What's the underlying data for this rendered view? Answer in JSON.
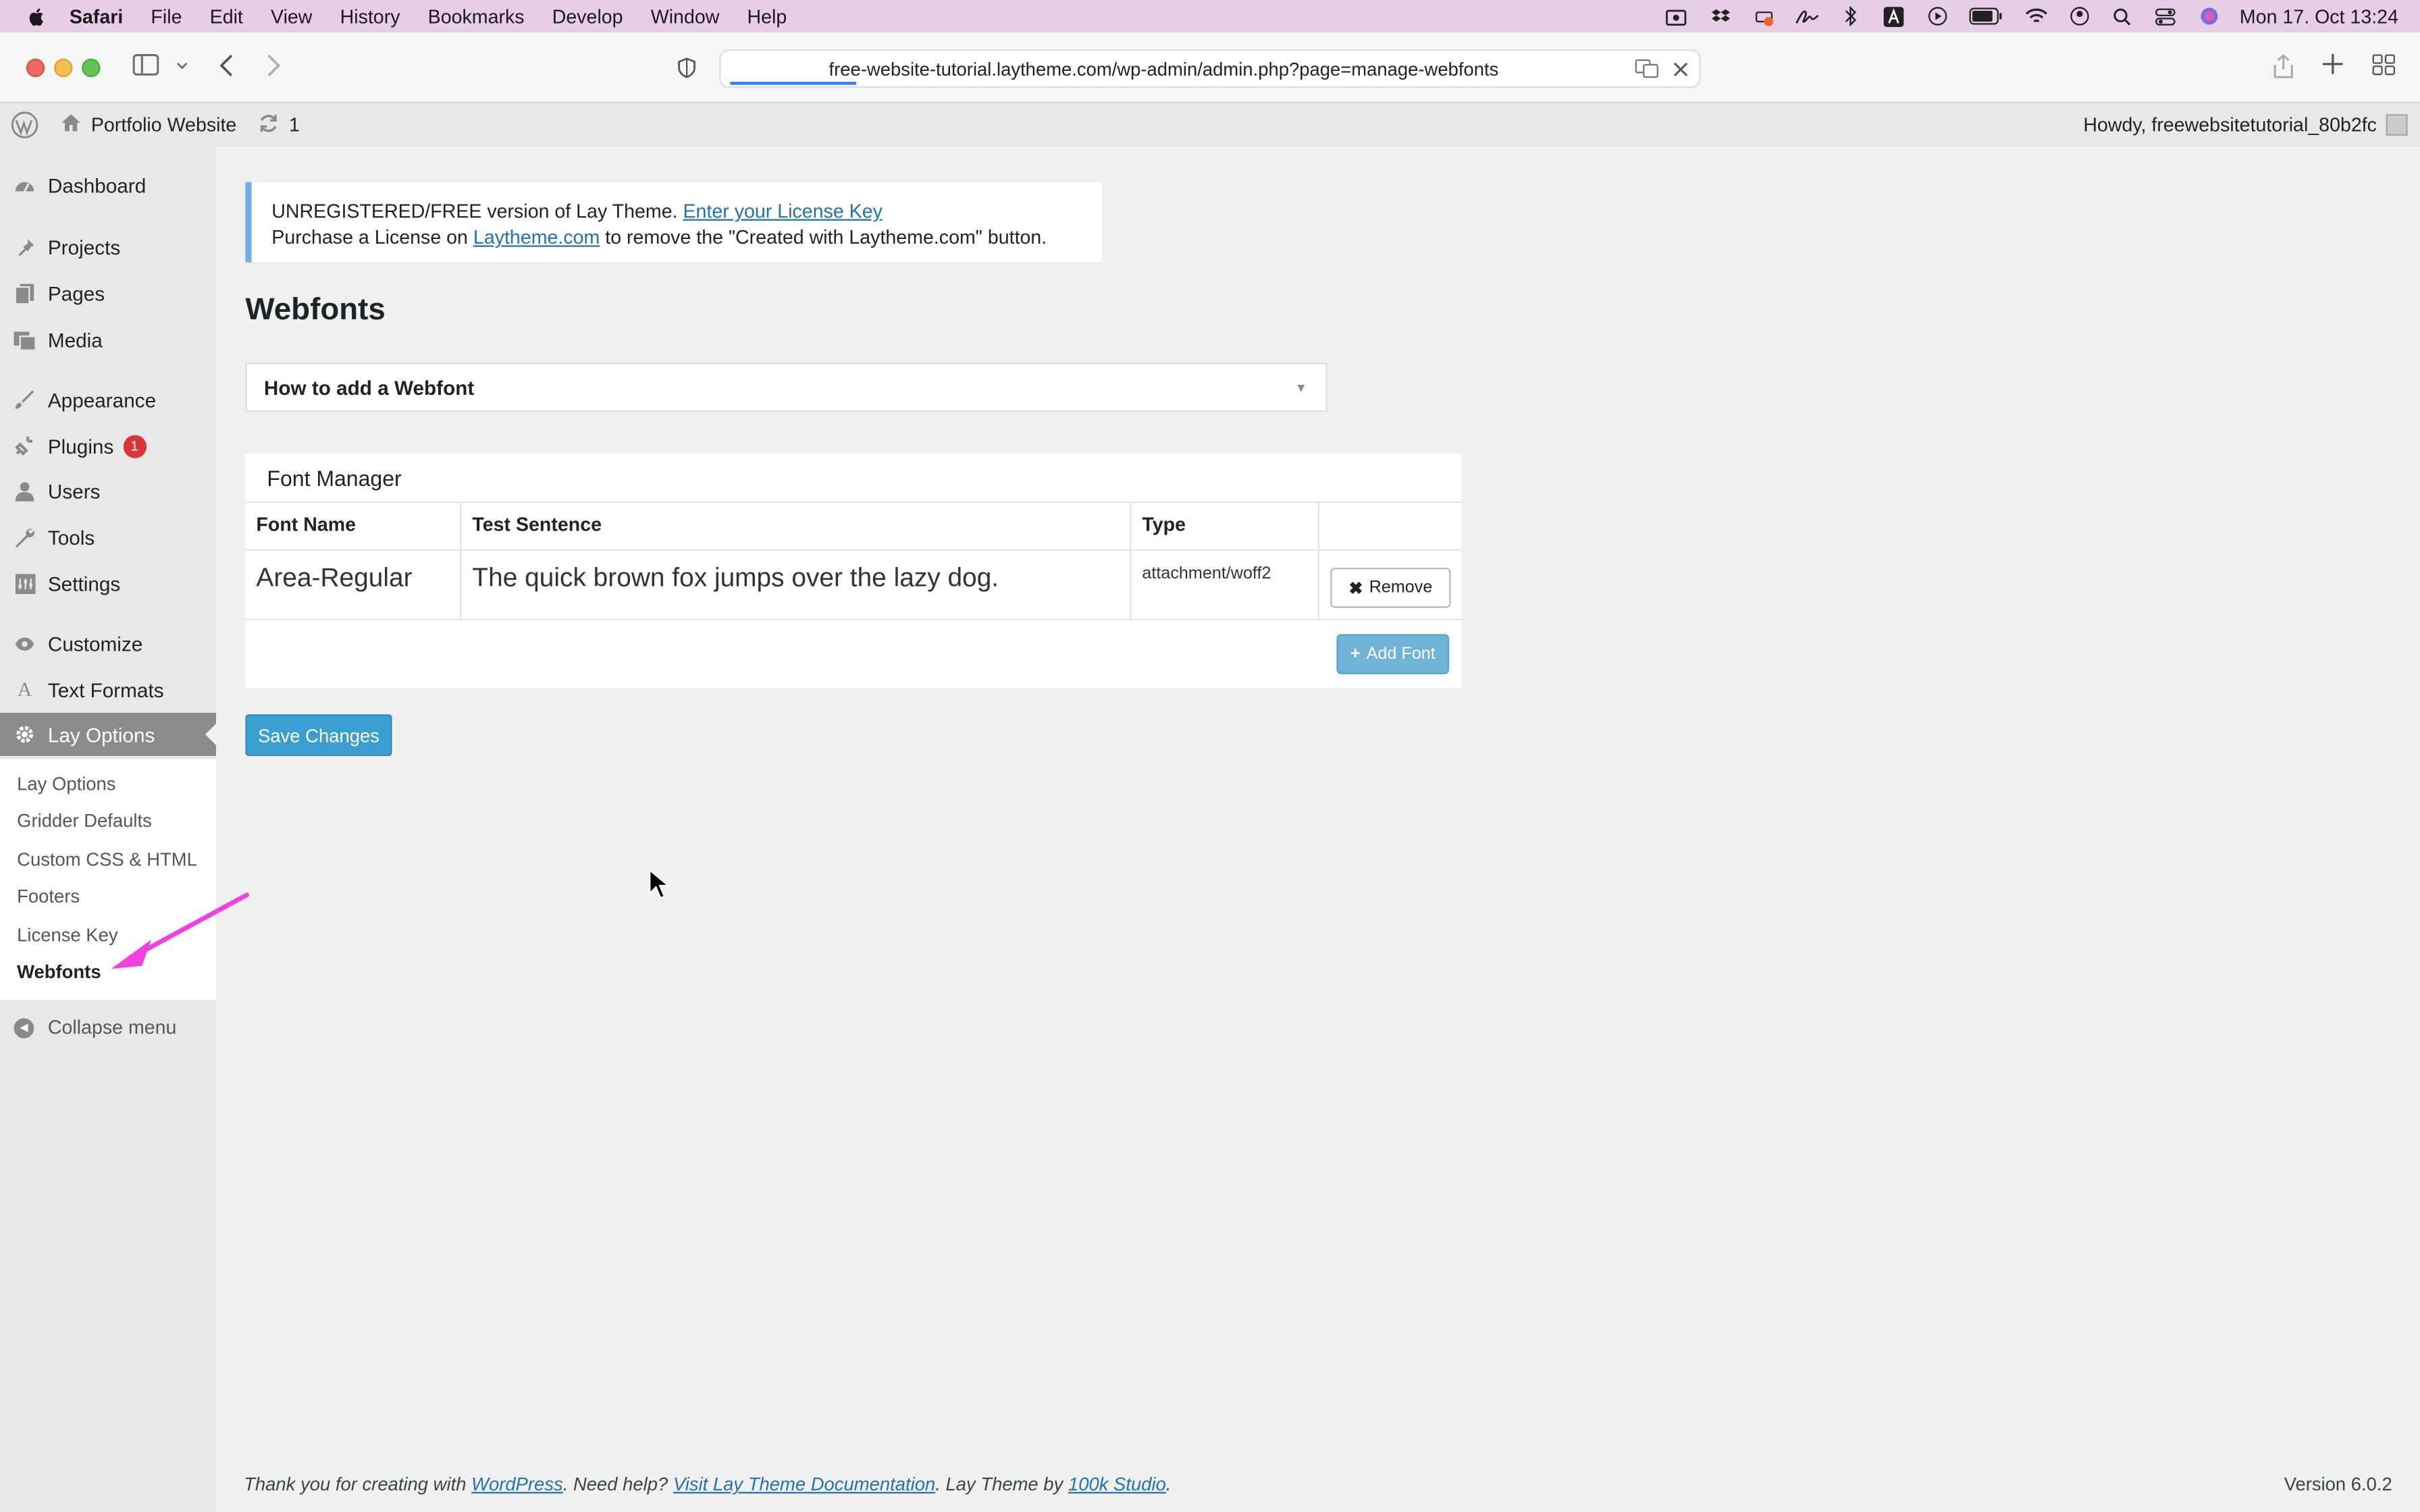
{
  "menubar": {
    "app": "Safari",
    "items": [
      "File",
      "Edit",
      "View",
      "History",
      "Bookmarks",
      "Develop",
      "Window",
      "Help"
    ],
    "clock": "Mon 17. Oct  13:24"
  },
  "browser": {
    "url": "free-website-tutorial.laytheme.com/wp-admin/admin.php?page=manage-webfonts"
  },
  "adminbar": {
    "site_name": "Portfolio Website",
    "updates_count": "1",
    "howdy": "Howdy, freewebsitetutorial_80b2fc"
  },
  "sidebar": {
    "items": [
      {
        "label": "Dashboard",
        "icon": "dashboard-icon"
      },
      {
        "label": "Projects",
        "icon": "pin-icon"
      },
      {
        "label": "Pages",
        "icon": "pages-icon"
      },
      {
        "label": "Media",
        "icon": "media-icon"
      },
      {
        "label": "Appearance",
        "icon": "brush-icon"
      },
      {
        "label": "Plugins",
        "icon": "plugin-icon",
        "badge": "1"
      },
      {
        "label": "Users",
        "icon": "user-icon"
      },
      {
        "label": "Tools",
        "icon": "wrench-icon"
      },
      {
        "label": "Settings",
        "icon": "settings-icon"
      },
      {
        "label": "Customize",
        "icon": "eye-icon"
      },
      {
        "label": "Text Formats",
        "icon": "text-icon"
      },
      {
        "label": "Lay Options",
        "icon": "gear-icon"
      }
    ],
    "submenu": [
      "Lay Options",
      "Gridder Defaults",
      "Custom CSS & HTML",
      "Footers",
      "License Key",
      "Webfonts"
    ],
    "collapse_label": "Collapse menu"
  },
  "notice": {
    "line1_text": "UNREGISTERED/FREE version of Lay Theme.",
    "line1_link": "Enter your License Key",
    "line2_pre": "Purchase a License on",
    "line2_link": "Laytheme.com",
    "line2_post": "to remove the \"Created with Laytheme.com\" button."
  },
  "page": {
    "title": "Webfonts",
    "accordion_label": "How to add a Webfont"
  },
  "font_manager": {
    "title": "Font Manager",
    "columns": [
      "Font Name",
      "Test Sentence",
      "Type"
    ],
    "rows": [
      {
        "font_name": "Area-Regular",
        "test_sentence": "The quick brown fox jumps over the lazy dog.",
        "type": "attachment/woff2"
      }
    ],
    "remove_label": "Remove",
    "add_label": "Add Font"
  },
  "save_label": "Save Changes",
  "footer": {
    "t1": "Thank you for creating with",
    "l1": "WordPress",
    "t2": ". Need help?",
    "l2": "Visit Lay Theme Documentation",
    "t3": ". Lay Theme by",
    "l3": "100k Studio",
    "t4": ".",
    "version": "Version 6.0.2"
  },
  "colors": {
    "menubar_bg": "#e6cfe6",
    "wp_link": "#2271b1",
    "notice_border": "#72aee6",
    "save_button": "#3a9fd0",
    "annotation_arrow": "#f23fe0"
  }
}
